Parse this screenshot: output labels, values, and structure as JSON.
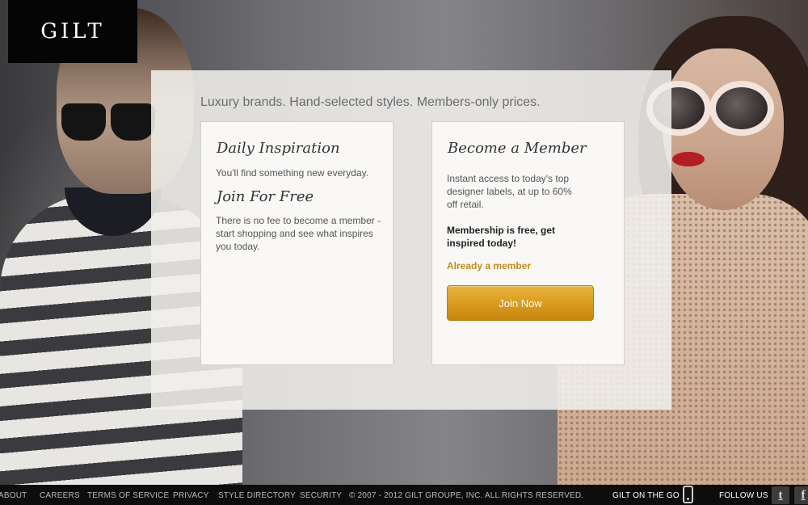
{
  "brand": {
    "logo_text": "GILT"
  },
  "panel": {
    "tagline": "Luxury brands. Hand-selected styles. Members-only prices.",
    "left_card": {
      "heading_daily": "Daily Inspiration",
      "text_daily": "You'll find something new everyday.",
      "heading_join": "Join For Free",
      "text_join": "There is no fee to become a member - start shopping and see what inspires you today."
    },
    "right_card": {
      "heading": "Become a Member",
      "text_access": "Instant access to today's top designer labels, at up to 60% off retail.",
      "text_free": "Membership is free, get inspired today!",
      "member_link": "Already a member",
      "join_button": "Join Now"
    }
  },
  "footer": {
    "links": {
      "about": "ABOUT",
      "careers": "CAREERS",
      "terms": "TERMS OF SERVICE",
      "privacy": "PRIVACY",
      "style_directory": "STYLE DIRECTORY",
      "security": "SECURITY"
    },
    "copyright": "© 2007 - 2012 GILT GROUPE, INC. ALL RIGHTS RESERVED.",
    "gilt_on_the_go": "GILT ON THE GO",
    "follow_us": "FOLLOW US",
    "twitter_glyph": "t",
    "facebook_glyph": "f"
  },
  "icons": {
    "phone": "phone-icon",
    "twitter": "twitter-icon",
    "facebook": "facebook-icon"
  },
  "colors": {
    "accent_gold": "#d99a1d",
    "link_gold": "#c08b1c",
    "logo_bg": "#050505",
    "footer_bg": "#0d0d0d"
  }
}
